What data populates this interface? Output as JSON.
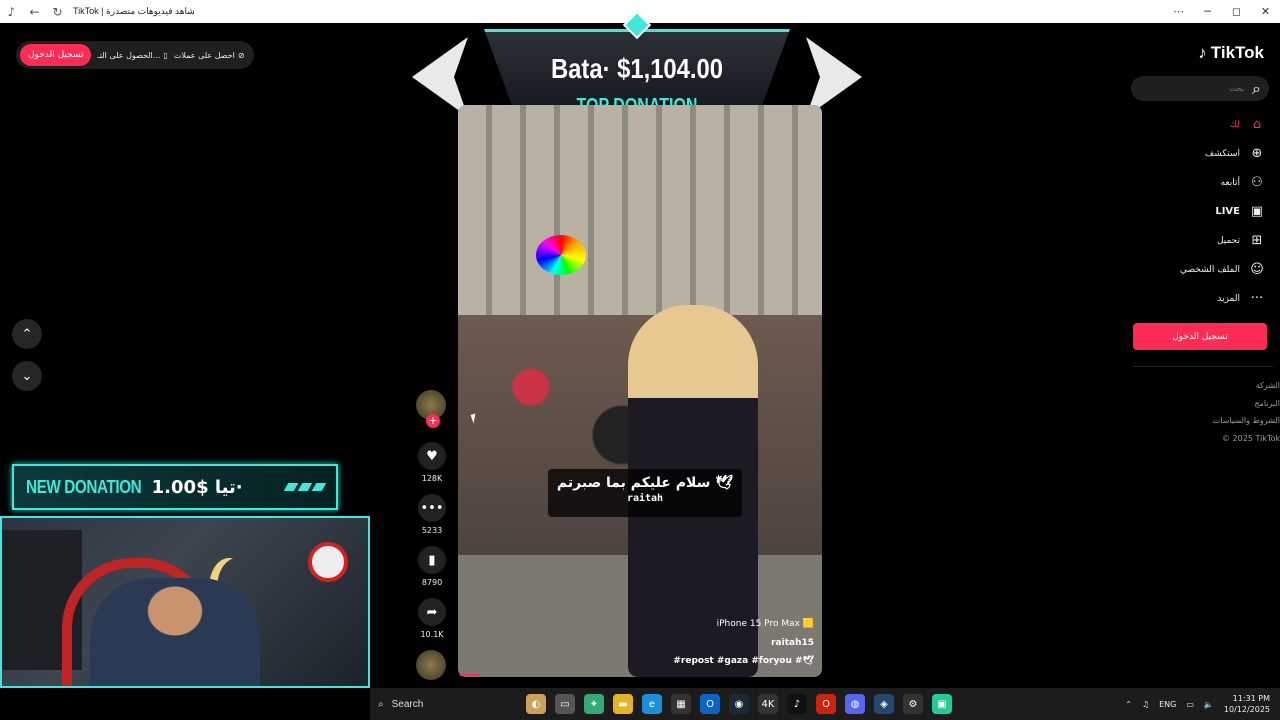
{
  "window": {
    "title": "TikTok | شاهد فيديوهات متصدرة",
    "controls": {
      "menu": "⋯",
      "minimize": "─",
      "maximize": "◻",
      "close": "✕"
    }
  },
  "topbar": {
    "login": "تسجيل الدخول",
    "get_app": "الحصول على التـ...",
    "get_coins": "احصل على عملات"
  },
  "nav": {
    "up": "⌃",
    "down": "⌄"
  },
  "overlay": {
    "top_donation_amount": "Bata· $1,104.00",
    "top_donation_label": "TOP DONATION",
    "new_donation_label": "NEW DONATION",
    "new_donation_amount": "1.00$ تيا·"
  },
  "video": {
    "caption_line1": "سلام عليكم بما صبرتم 🕊",
    "caption_line2": "raitah",
    "device": "iPhone 15 Pro Max 🟨",
    "username": "raitah15",
    "hashtags": "#repost #gaza #foryou #🕊"
  },
  "actions": {
    "likes": "128K",
    "comments": "5233",
    "saves": "8790",
    "shares": "10.1K"
  },
  "sidebar": {
    "logo": "TikTok",
    "search_placeholder": "بحث",
    "items": [
      {
        "label": "لك",
        "icon": "home-icon"
      },
      {
        "label": "استكشف",
        "icon": "compass-icon"
      },
      {
        "label": "أتابعه",
        "icon": "user-follow-icon"
      },
      {
        "label": "LIVE",
        "icon": "live-icon"
      },
      {
        "label": "تحميل",
        "icon": "upload-icon"
      },
      {
        "label": "الملف الشخصي",
        "icon": "profile-icon"
      },
      {
        "label": "المزيد",
        "icon": "more-icon"
      }
    ],
    "login": "تسجيل الدخول",
    "links": [
      "الشركة",
      "البرنامج",
      "الشروط والسياسات",
      "© 2025 TikTok"
    ]
  },
  "taskbar": {
    "search": "Search",
    "lang": "ENG",
    "time": "11:31 PM",
    "date": "10/12/2025"
  },
  "colors": {
    "accent": "#fe2c55",
    "overlay": "#3ee8dc"
  }
}
